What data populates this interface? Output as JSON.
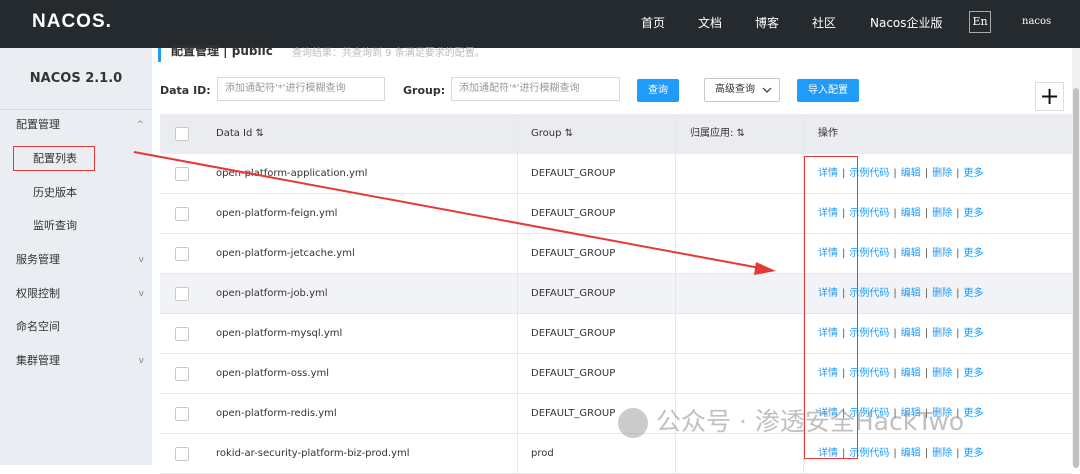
{
  "topbar": {
    "logo": "NACOS.",
    "nav": [
      "首页",
      "文档",
      "博客",
      "社区",
      "Nacos企业版"
    ],
    "lang": "En",
    "user": "nacos"
  },
  "sidebar": {
    "brand": "NACOS 2.1.0",
    "items": [
      {
        "label": "配置管理",
        "chevron": "^"
      },
      {
        "label": "配置列表"
      },
      {
        "label": "历史版本"
      },
      {
        "label": "监听查询"
      },
      {
        "label": "服务管理",
        "chevron": "v"
      },
      {
        "label": "权限控制",
        "chevron": "v"
      },
      {
        "label": "命名空间"
      },
      {
        "label": "集群管理",
        "chevron": "v"
      }
    ]
  },
  "breadcrumb": {
    "title": "配置管理  |  public",
    "hint": "查询结果：共查询到 9 条满足要求的配置。"
  },
  "filters": {
    "dataid_label": "Data ID:",
    "dataid_placeholder": "添加通配符'*'进行模糊查询",
    "group_label": "Group:",
    "group_placeholder": "添加通配符'*'进行模糊查询",
    "query_button": "查询",
    "advanced_label": "高级查询",
    "import_button": "导入配置",
    "add_button": "+"
  },
  "table": {
    "headers": [
      "Data Id  ⇅",
      "Group  ⇅",
      "归属应用:  ⇅",
      "操作"
    ],
    "ops": [
      "详情",
      "示例代码",
      "编辑",
      "删除",
      "更多"
    ],
    "rows": [
      {
        "data_id": "open-platform-application.yml",
        "group": "DEFAULT_GROUP",
        "app": ""
      },
      {
        "data_id": "open-platform-feign.yml",
        "group": "DEFAULT_GROUP",
        "app": ""
      },
      {
        "data_id": "open-platform-jetcache.yml",
        "group": "DEFAULT_GROUP",
        "app": ""
      },
      {
        "data_id": "open-platform-job.yml",
        "group": "DEFAULT_GROUP",
        "app": ""
      },
      {
        "data_id": "open-platform-mysql.yml",
        "group": "DEFAULT_GROUP",
        "app": ""
      },
      {
        "data_id": "open-platform-oss.yml",
        "group": "DEFAULT_GROUP",
        "app": ""
      },
      {
        "data_id": "open-platform-redis.yml",
        "group": "DEFAULT_GROUP",
        "app": ""
      },
      {
        "data_id": "rokid-ar-security-platform-biz-prod.yml",
        "group": "prod",
        "app": ""
      }
    ]
  },
  "watermark": "公众号 · 渗透安全HackTwo",
  "colors": {
    "accent": "#209bfa",
    "annotation": "#e53935",
    "topbar": "#252a2f"
  }
}
